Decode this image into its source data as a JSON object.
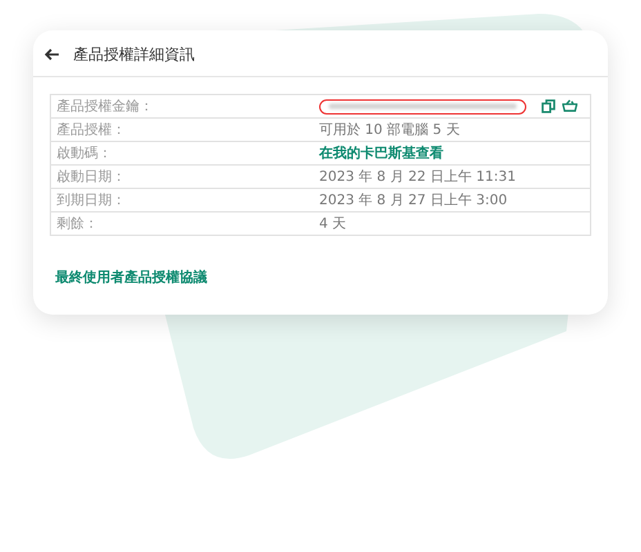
{
  "header": {
    "title": "產品授權詳細資訊"
  },
  "details": [
    {
      "label": "產品授權金鑰：",
      "kind": "masked",
      "highlighted": true
    },
    {
      "label": "產品授權：",
      "kind": "text",
      "value": "可用於 10 部電腦 5 天"
    },
    {
      "label": "啟動碼：",
      "kind": "link",
      "value": "在我的卡巴斯基查看"
    },
    {
      "label": "啟動日期：",
      "kind": "text",
      "value": "2023 年 8 月 22 日上午 11:31"
    },
    {
      "label": "到期日期：",
      "kind": "text",
      "value": "2023 年 8 月 27 日上午 3:00"
    },
    {
      "label": "剩餘：",
      "kind": "text",
      "value": "4 天"
    }
  ],
  "footer_link": "最終使用者產品授權協議"
}
